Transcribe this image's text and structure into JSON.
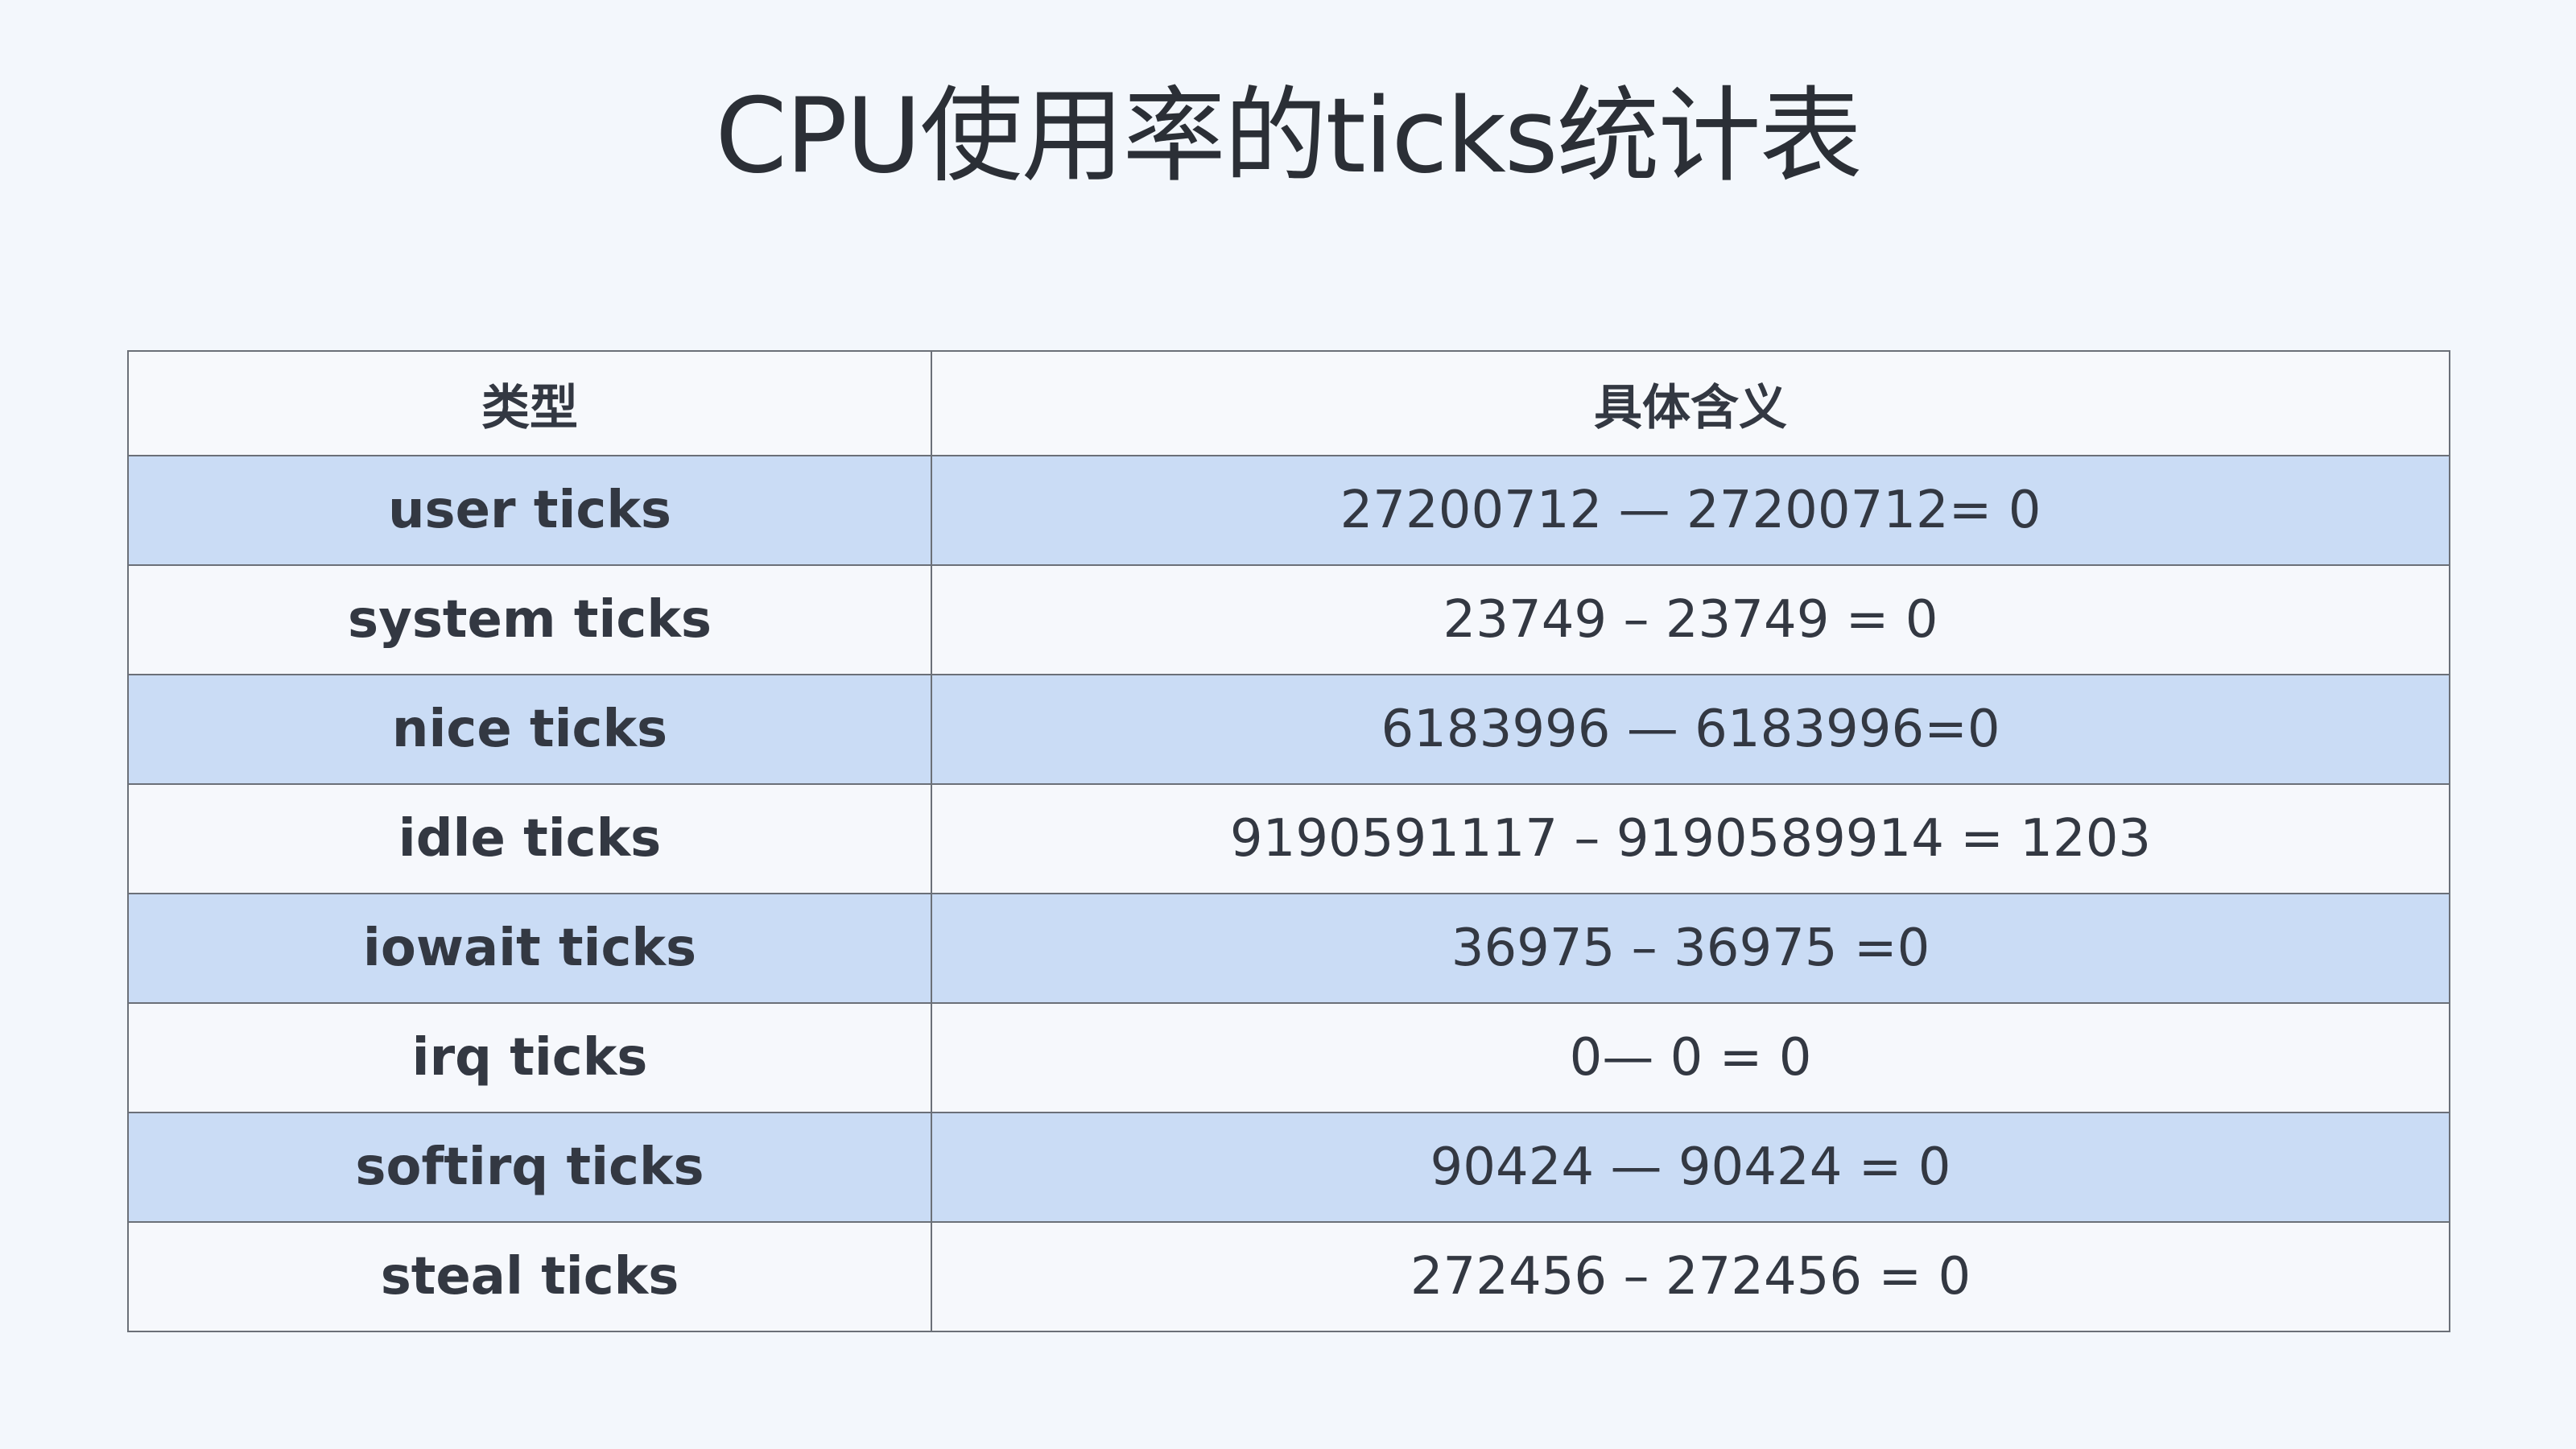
{
  "title": "CPU使用率的ticks统计表",
  "table": {
    "headers": [
      "类型",
      "具体含义"
    ],
    "rows": [
      {
        "type": "user ticks",
        "meaning": "27200712 — 27200712= 0"
      },
      {
        "type": "system ticks",
        "meaning": "23749 – 23749 = 0"
      },
      {
        "type": "nice ticks",
        "meaning": "6183996 — 6183996=0"
      },
      {
        "type": "idle ticks",
        "meaning": "9190591117 – 9190589914 = 1203"
      },
      {
        "type": "iowait ticks",
        "meaning": "36975 – 36975 =0"
      },
      {
        "type": "irq ticks",
        "meaning": "0— 0 = 0"
      },
      {
        "type": "softirq ticks",
        "meaning": "90424 — 90424 = 0"
      },
      {
        "type": "steal ticks",
        "meaning": "272456 – 272456 = 0"
      }
    ]
  },
  "colors": {
    "background": "#f3f7fc",
    "row_highlight": "#cadcf5",
    "row_plain": "#f6f8fc",
    "border": "#6b7078",
    "text": "#333842"
  }
}
